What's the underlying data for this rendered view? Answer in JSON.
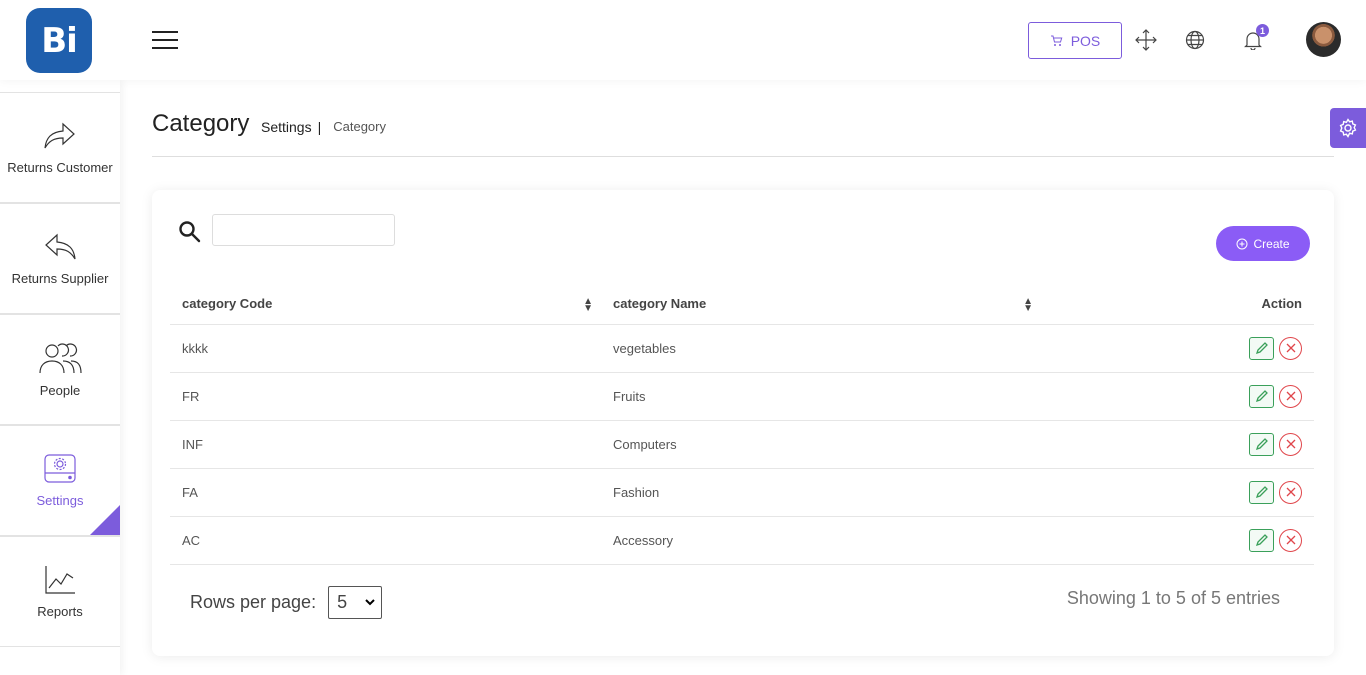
{
  "header": {
    "logo_text": "Bi",
    "pos_label": "POS",
    "notification_count": "1"
  },
  "sidebar": {
    "items": [
      {
        "label": "Returns Customer",
        "icon": "share-forward-icon"
      },
      {
        "label": "Returns Supplier",
        "icon": "reply-icon"
      },
      {
        "label": "People",
        "icon": "people-icon"
      },
      {
        "label": "Settings",
        "icon": "settings-drive-icon",
        "active": true
      },
      {
        "label": "Reports",
        "icon": "line-chart-icon"
      }
    ]
  },
  "page": {
    "title": "Category",
    "breadcrumb_parent": "Settings",
    "breadcrumb_separator": "|",
    "breadcrumb_current": "Category"
  },
  "toolbar": {
    "search_placeholder": "",
    "create_label": "Create"
  },
  "table": {
    "headers": [
      "category Code",
      "category Name",
      "Action"
    ],
    "rows": [
      {
        "code": "kkkk",
        "name": "vegetables"
      },
      {
        "code": "FR",
        "name": "Fruits"
      },
      {
        "code": "INF",
        "name": "Computers"
      },
      {
        "code": "FA",
        "name": "Fashion"
      },
      {
        "code": "AC",
        "name": "Accessory"
      }
    ]
  },
  "footer": {
    "rows_per_page_label": "Rows per page:",
    "rows_per_page_value": "5",
    "showing_text": "Showing 1 to 5 of 5 entries"
  },
  "colors": {
    "accent": "#7c5cdc",
    "create_button": "#8b5cf6",
    "logo_bg": "#1f5fad",
    "edit_green": "#3aa05a",
    "delete_red": "#e0464b"
  }
}
